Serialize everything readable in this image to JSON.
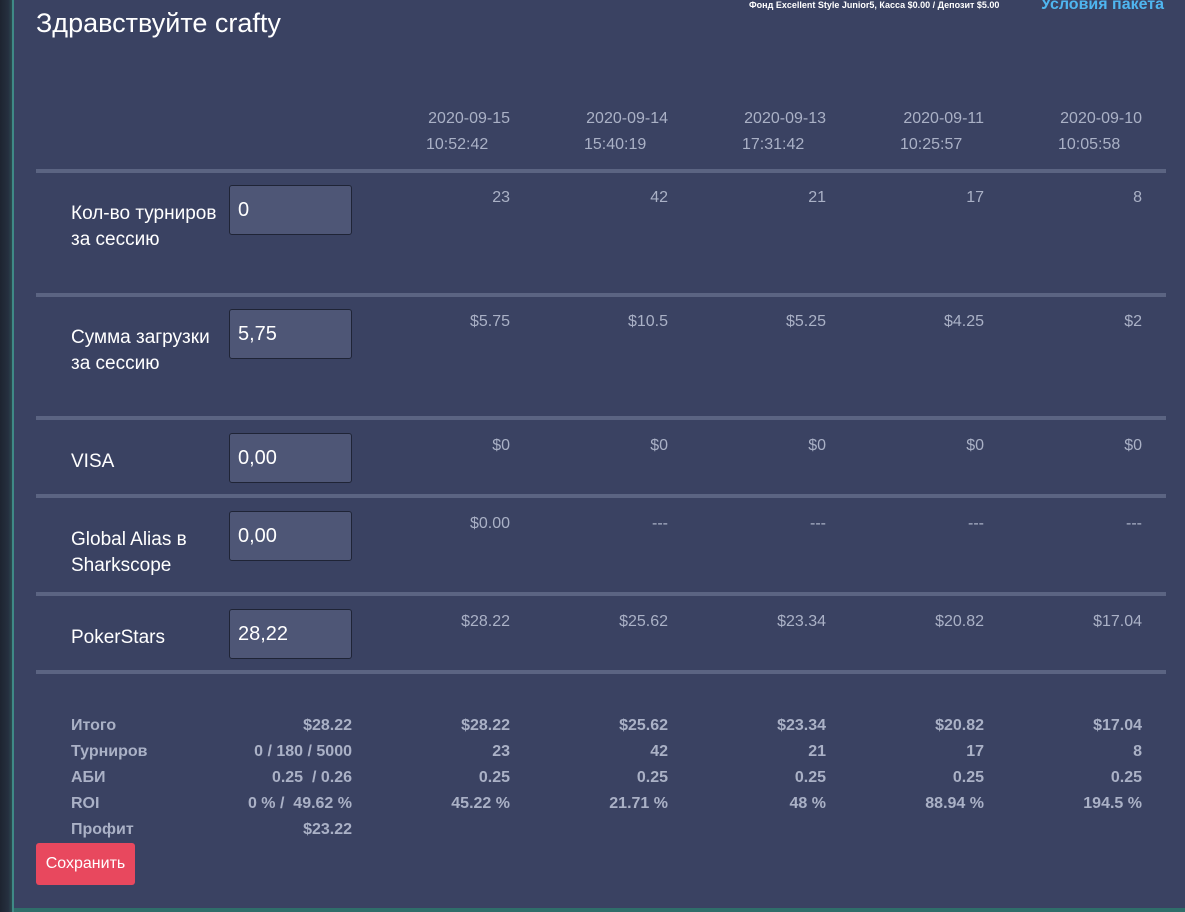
{
  "header": {
    "greeting": "Здравствуйте crafty",
    "fund_info": "Фонд Excellent Style Junior5, Касса $0.00 / Депозит $5.00",
    "terms_link": "Условия пакета"
  },
  "dates": [
    {
      "date": "2020-09-15",
      "time": "10:52:42"
    },
    {
      "date": "2020-09-14",
      "time": "15:40:19"
    },
    {
      "date": "2020-09-13",
      "time": "17:31:42"
    },
    {
      "date": "2020-09-11",
      "time": "10:25:57"
    },
    {
      "date": "2020-09-10",
      "time": "10:05:58"
    }
  ],
  "rows": [
    {
      "label": "Кол-во турниров за сессию",
      "input_value": "0",
      "values": [
        "23",
        "42",
        "21",
        "17",
        "8"
      ]
    },
    {
      "label": "Сумма загрузки за сессию",
      "input_value": "5,75",
      "values": [
        "$5.75",
        "$10.5",
        "$5.25",
        "$4.25",
        "$2"
      ]
    },
    {
      "label": "VISA",
      "input_value": "0,00",
      "values": [
        "$0",
        "$0",
        "$0",
        "$0",
        "$0"
      ]
    },
    {
      "label": "Global Alias в Sharkscope",
      "input_value": "0,00",
      "values": [
        "$0.00",
        "---",
        "---",
        "---",
        "---"
      ]
    },
    {
      "label": "PokerStars",
      "input_value": "28,22",
      "values": [
        "$28.22",
        "$25.62",
        "$23.34",
        "$20.82",
        "$17.04"
      ]
    }
  ],
  "summary": [
    {
      "label": "Итого",
      "total": "$28.22",
      "values": [
        "$28.22",
        "$25.62",
        "$23.34",
        "$20.82",
        "$17.04"
      ]
    },
    {
      "label": "Турниров",
      "total": "0 / 180 / 5000",
      "values": [
        "23",
        "42",
        "21",
        "17",
        "8"
      ]
    },
    {
      "label": "АБИ",
      "total": "0.25  / 0.26",
      "values": [
        "0.25",
        "0.25",
        "0.25",
        "0.25",
        "0.25"
      ]
    },
    {
      "label": "ROI",
      "total": "0 % /  49.62 %",
      "values": [
        "45.22 %",
        "21.71 %",
        "48 %",
        "88.94 %",
        "194.5 %"
      ]
    },
    {
      "label": "Профит",
      "total": "$23.22",
      "values": [
        "",
        "",
        "",
        "",
        ""
      ]
    }
  ],
  "actions": {
    "save_label": "Сохранить"
  }
}
